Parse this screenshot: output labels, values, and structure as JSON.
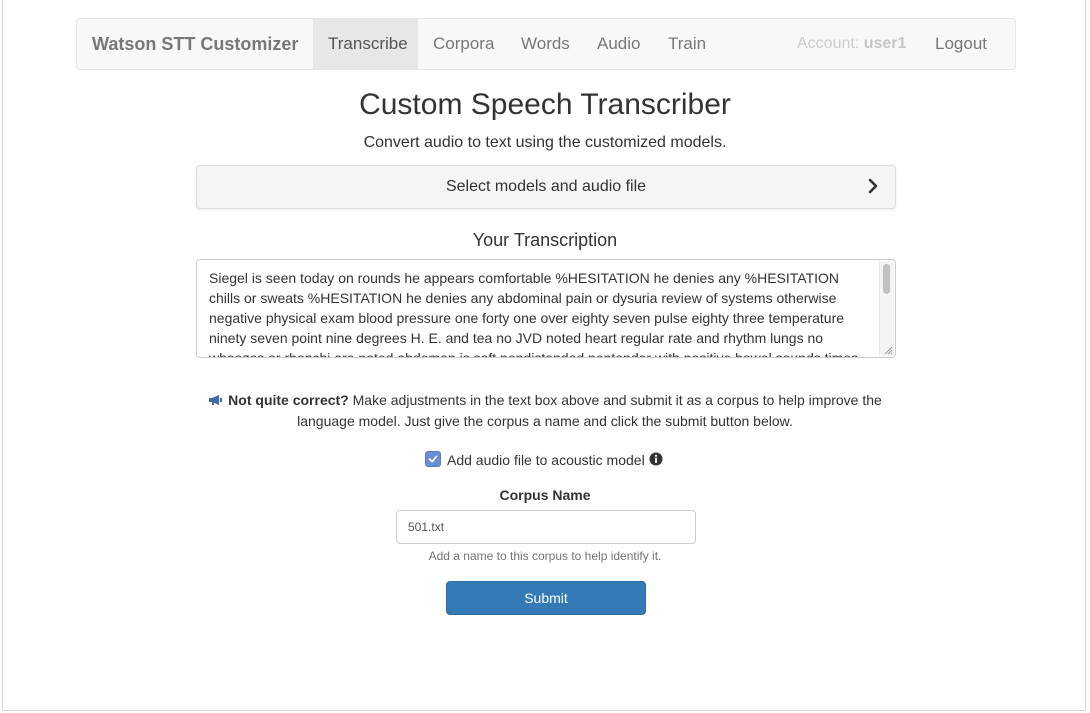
{
  "navbar": {
    "brand": "Watson STT Customizer",
    "items": [
      {
        "label": "Transcribe",
        "active": true
      },
      {
        "label": "Corpora",
        "active": false
      },
      {
        "label": "Words",
        "active": false
      },
      {
        "label": "Audio",
        "active": false
      },
      {
        "label": "Train",
        "active": false
      }
    ],
    "account_label": "Account:",
    "account_user": "user1",
    "logout": "Logout"
  },
  "page": {
    "title": "Custom Speech Transcriber",
    "subtitle": "Convert audio to text using the customized models."
  },
  "panel": {
    "label": "Select models and audio file",
    "icon": "chevron-right-icon"
  },
  "transcription": {
    "heading": "Your Transcription",
    "text": "Siegel is seen today on rounds he appears comfortable %HESITATION he denies any %HESITATION chills or sweats %HESITATION he denies any abdominal pain or dysuria review of systems otherwise negative physical exam blood pressure one forty one over eighty seven pulse eighty three temperature ninety seven point nine degrees H. E. and tea no JVD noted heart regular rate and rhythm lungs no wheezes or rhonchi are noted abdomen is soft nondistended nontender with positive bowel sounds times"
  },
  "note": {
    "bold": "Not quite correct?",
    "text": " Make adjustments in the text box above and submit it as a corpus to help improve the language model. Just give the corpus a name and click the submit button below."
  },
  "acoustic": {
    "label": "Add audio file to acoustic model",
    "checked": true
  },
  "corpus": {
    "label": "Corpus Name",
    "value": "501.txt",
    "help": "Add a name to this corpus to help identify it."
  },
  "submit_label": "Submit",
  "colors": {
    "primary": "#337ab7",
    "navbar_bg": "#f8f8f8",
    "active_tab_bg": "#e7e7e7",
    "checkbox": "#6b8dd6"
  }
}
